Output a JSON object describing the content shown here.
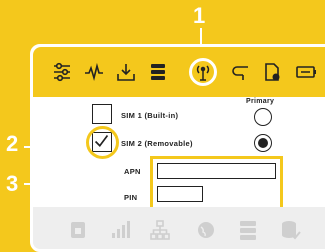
{
  "callouts": [
    "1",
    "2",
    "3"
  ],
  "header": {
    "primary_label": "Primary"
  },
  "sims": [
    {
      "label": "SIM 1 (Built-in)",
      "checked": false,
      "primary": false
    },
    {
      "label": "SIM 2 (Removable)",
      "checked": true,
      "primary": true
    }
  ],
  "fields": {
    "apn_label": "APN",
    "apn_value": "",
    "pin_label": "PIN",
    "pin_value": ""
  },
  "toolbar_icons": [
    "equalizer-icon",
    "pulse-icon",
    "download-tray-icon",
    "server-icon",
    "antenna-icon",
    "connector-icon",
    "document-gear-icon",
    "battery-icon"
  ],
  "bottom_icons": [
    "sim-card-icon",
    "signal-bars-icon",
    "network-tree-icon",
    "globe-icon",
    "server-stack-icon",
    "database-check-icon"
  ],
  "colors": {
    "accent": "#f4c81c",
    "background": "#ffffff",
    "bottom_bar": "#eeeeee",
    "ink": "#222222"
  }
}
